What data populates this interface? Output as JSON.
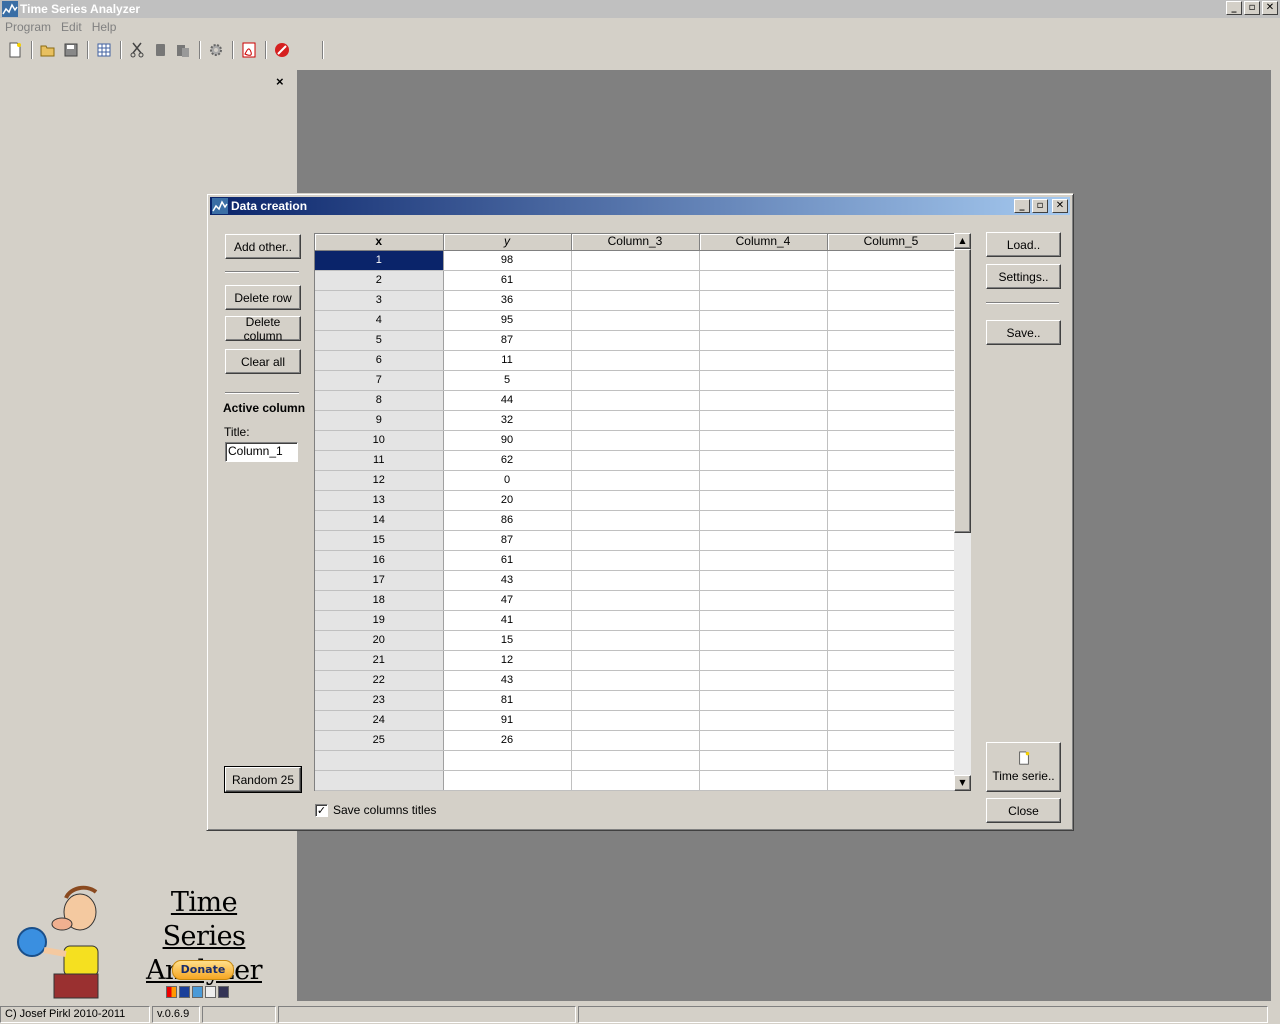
{
  "app": {
    "title": "Time Series Analyzer",
    "menu": [
      "Program",
      "Edit",
      "Help"
    ],
    "logo_line1": "Time Series",
    "logo_line2": "Analyzer",
    "donate_label": "Donate",
    "panel_close": "×"
  },
  "window_buttons": {
    "minimize": "_",
    "restore": "▫",
    "close": "✕"
  },
  "statusbar": {
    "copyright": "C) Josef Pirkl 2010-2011",
    "version": "v.0.6.9"
  },
  "dialog": {
    "title": "Data creation",
    "left": {
      "add_other": "Add other..",
      "delete_row": "Delete row",
      "delete_column": "Delete column",
      "clear_all": "Clear all",
      "active_column_heading": "Active column",
      "title_label": "Title:",
      "title_value": "Column_1",
      "random_button": "Random 25"
    },
    "right": {
      "load": "Load..",
      "settings": "Settings..",
      "save": "Save..",
      "time_series": "Time serie..",
      "close": "Close"
    },
    "save_titles_label": "Save columns titles",
    "save_titles_checked": true,
    "grid": {
      "columns": [
        "x",
        "y",
        "Column_3",
        "Column_4",
        "Column_5"
      ],
      "selected_row": 0,
      "rows": [
        [
          "1",
          "98"
        ],
        [
          "2",
          "61"
        ],
        [
          "3",
          "36"
        ],
        [
          "4",
          "95"
        ],
        [
          "5",
          "87"
        ],
        [
          "6",
          "11"
        ],
        [
          "7",
          "5"
        ],
        [
          "8",
          "44"
        ],
        [
          "9",
          "32"
        ],
        [
          "10",
          "90"
        ],
        [
          "11",
          "62"
        ],
        [
          "12",
          "0"
        ],
        [
          "13",
          "20"
        ],
        [
          "14",
          "86"
        ],
        [
          "15",
          "87"
        ],
        [
          "16",
          "61"
        ],
        [
          "17",
          "43"
        ],
        [
          "18",
          "47"
        ],
        [
          "19",
          "41"
        ],
        [
          "20",
          "15"
        ],
        [
          "21",
          "12"
        ],
        [
          "22",
          "43"
        ],
        [
          "23",
          "81"
        ],
        [
          "24",
          "91"
        ],
        [
          "25",
          "26"
        ],
        [
          "",
          ""
        ],
        [
          "",
          ""
        ]
      ]
    }
  }
}
